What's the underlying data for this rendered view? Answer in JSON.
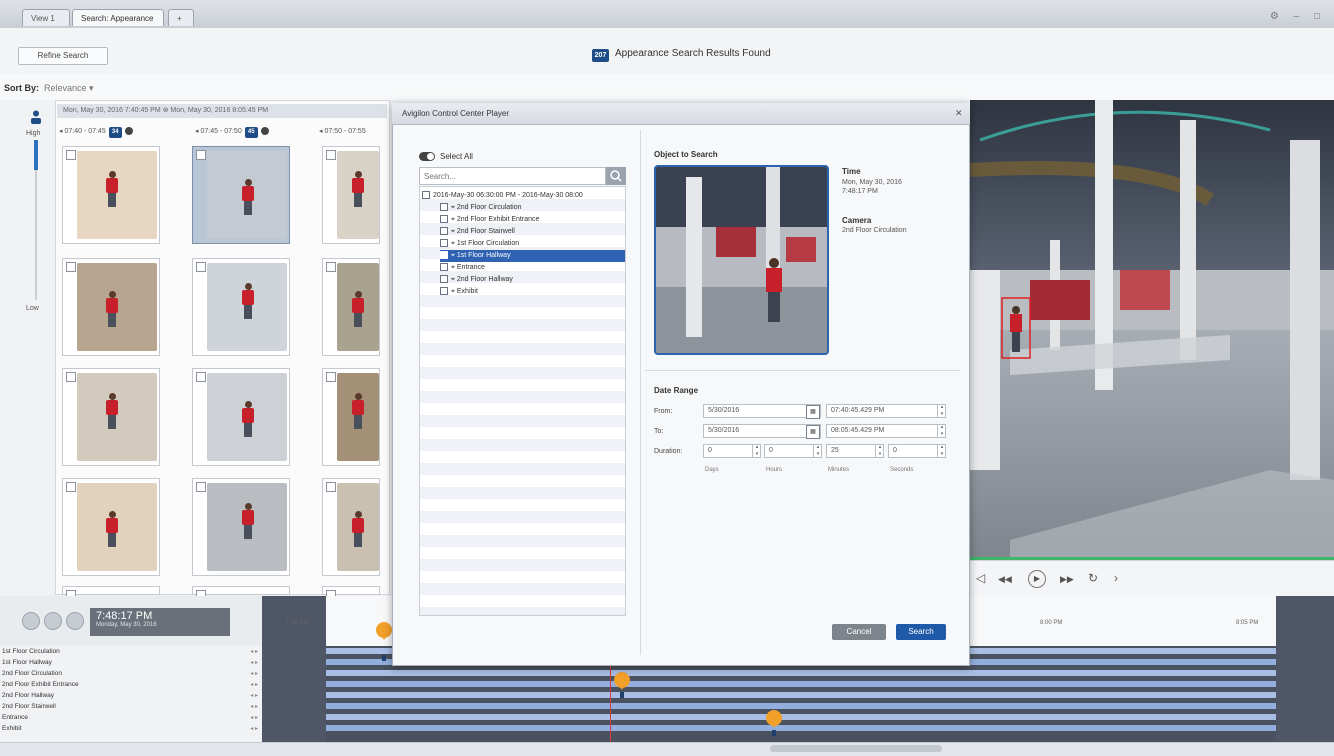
{
  "tabs": [
    {
      "label": "View 1 ×"
    },
    {
      "label": "Search: Appearance ×"
    },
    {
      "label": "+"
    }
  ],
  "window_controls": "⚙ – □",
  "toolbar": {
    "refine_label": "Refine Search",
    "results_count": "207",
    "results_text": "Appearance Search Results Found"
  },
  "sort": {
    "label": "Sort By:",
    "value": "Relevance ▾"
  },
  "confidence": {
    "high": "High",
    "low": "Low"
  },
  "grid": {
    "range_header": "Mon, May 30, 2016 7:40:45 PM  ⊗  Mon, May 30, 2016 8:05:45 PM",
    "buckets": [
      {
        "label": "◂ 07:40 - 07:45",
        "count": "34"
      },
      {
        "label": "◂ 07:45 - 07:50",
        "count": "45"
      },
      {
        "label": "◂ 07:50 - 07:55",
        "count": ""
      }
    ]
  },
  "timeline": {
    "time": "7:48:17 PM",
    "date": "Monday, May 30, 2016",
    "scale_labels": [
      "7:45 PM",
      "8:00 PM",
      "8:05 PM"
    ],
    "cameras": [
      "1st Floor Circulation",
      "1st Floor Hallway",
      "2nd Floor Circulation",
      "2nd Floor Exhibit Entrance",
      "2nd Floor Hallway",
      "2nd Floor Stairwell",
      "Entrance",
      "Exhibit"
    ]
  },
  "dialog": {
    "title": "Avigilon Control Center Player",
    "close": "✕",
    "select_all": "Select All",
    "search_placeholder": "Search...",
    "tree": [
      {
        "label": "2016-May-30 06:30:00 PM - 2016-May-30 08:00"
      },
      {
        "label": "2nd Floor Circulation"
      },
      {
        "label": "2nd Floor Exhibit Entrance"
      },
      {
        "label": "2nd Floor Stairwell"
      },
      {
        "label": "1st Floor Circulation"
      },
      {
        "label": "1st Floor Hallway"
      },
      {
        "label": "Entrance"
      },
      {
        "label": "2nd Floor Hallway"
      },
      {
        "label": "Exhibit"
      }
    ],
    "object_title": "Object to Search",
    "time_label": "Time",
    "time_value": "Mon, May 30, 2016 7:48:17 PM",
    "camera_label": "Camera",
    "camera_value": "2nd Floor Circulation",
    "date_range_title": "Date Range",
    "from_label": "From:",
    "to_label": "To:",
    "duration_label": "Duration:",
    "from_date": "5/30/2016",
    "from_time": "07:40:45.429 PM",
    "to_date": "5/30/2016",
    "to_time": "08:05:45.429 PM",
    "duration": {
      "days": "0",
      "hours": "0",
      "minutes": "25",
      "seconds": "0"
    },
    "units": {
      "days": "Days",
      "hours": "Hours",
      "minutes": "Minutes",
      "seconds": "Seconds"
    },
    "cancel": "Cancel",
    "search": "Search"
  },
  "video_controls": [
    "◁",
    "◀◀",
    "▶",
    "▶▶",
    "↻",
    "›"
  ]
}
